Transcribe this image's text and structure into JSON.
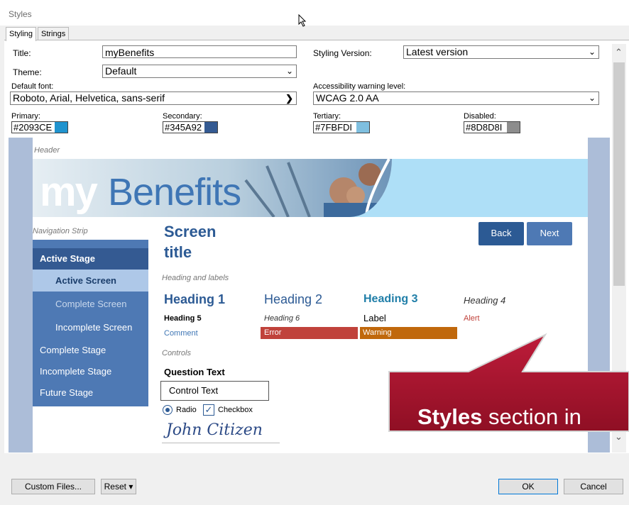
{
  "window": {
    "title": "Styles"
  },
  "tabs": [
    {
      "label": "Styling"
    },
    {
      "label": "Strings"
    }
  ],
  "form": {
    "title_label": "Title:",
    "title_value": "myBenefits",
    "styling_version_label": "Styling Version:",
    "styling_version_value": "Latest version",
    "theme_label": "Theme:",
    "theme_value": "Default",
    "default_font_label": "Default font:",
    "default_font_value": "Roboto, Arial, Helvetica, sans-serif",
    "accessibility_label": "Accessibility warning level:",
    "accessibility_value": "WCAG 2.0 AA",
    "colors": [
      {
        "label": "Primary:",
        "value": "#2093CE",
        "swatch": "#2093CE"
      },
      {
        "label": "Secondary:",
        "value": "#345A92",
        "swatch": "#345A92"
      },
      {
        "label": "Tertiary:",
        "value": "#7FBFDI",
        "swatch": "#7FBFDF"
      },
      {
        "label": "Disabled:",
        "value": "#8D8D8I",
        "swatch": "#8D8D8D"
      }
    ]
  },
  "preview": {
    "header_label": "Header",
    "logo_text_my": "my",
    "logo_text_benefits": "Benefits",
    "nav_strip_label": "Navigation Strip",
    "nav_items": [
      {
        "label": "Active Stage"
      },
      {
        "label": "Active Screen"
      },
      {
        "label": "Complete Screen"
      },
      {
        "label": "Incomplete Screen"
      },
      {
        "label": "Complete Stage"
      },
      {
        "label": "Incomplete Stage"
      },
      {
        "label": "Future Stage"
      }
    ],
    "screen_title_line1": "Screen",
    "screen_title_line2": "title",
    "back_label": "Back",
    "next_label": "Next",
    "headings_section_label": "Heading and labels",
    "heading1": "Heading 1",
    "heading2": "Heading 2",
    "heading3": "Heading 3",
    "heading4": "Heading 4",
    "heading5": "Heading 5",
    "heading6": "Heading 6",
    "label": "Label",
    "alert": "Alert",
    "comment": "Comment",
    "error": "Error",
    "warning": "Warning",
    "controls_label": "Controls",
    "question_text": "Question Text",
    "control_text": "Control Text",
    "radio_label": "Radio",
    "checkbox_label": "Checkbox",
    "signature": "John Citizen"
  },
  "callout": {
    "bold": "Styles",
    "rest": " section in"
  },
  "footer": {
    "custom_files_label": "Custom Files...",
    "reset_label": "Reset ▾",
    "ok_label": "OK",
    "cancel_label": "Cancel"
  },
  "colors": {
    "primary_blue": "#2c5a94",
    "nav_blue": "#4e79b4",
    "active_stage": "#345a92",
    "active_screen": "#aec8e8",
    "error_red": "#c0423b",
    "warning_orange": "#c0680c",
    "callout_red": "#a8142c"
  }
}
